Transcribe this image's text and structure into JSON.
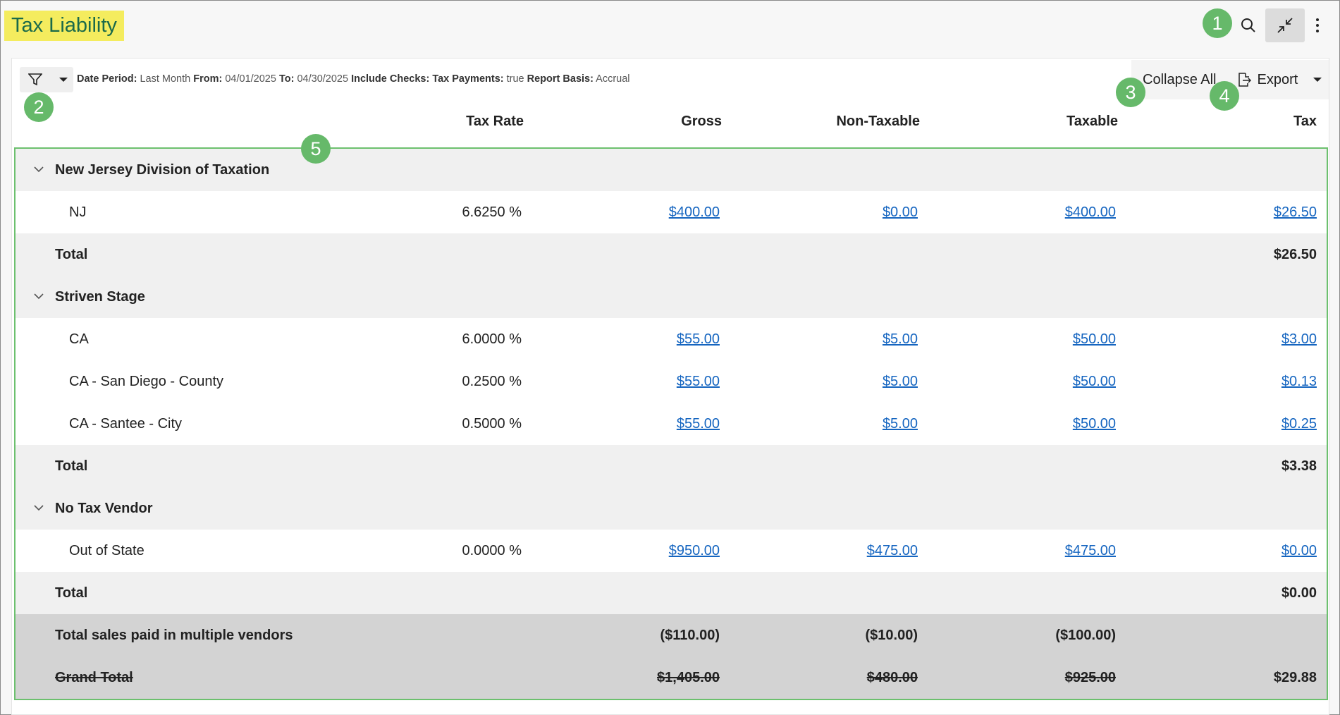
{
  "header": {
    "title": "Tax Liability"
  },
  "badges": [
    "1",
    "2",
    "3",
    "4",
    "5"
  ],
  "filter": {
    "date_period_label": "Date Period:",
    "date_period_value": "Last Month",
    "from_label": "From:",
    "from_value": "04/01/2025",
    "to_label": "To:",
    "to_value": "04/30/2025",
    "include_checks_label": "Include Checks:",
    "tax_payments_label": "Tax Payments:",
    "tax_payments_value": "true",
    "report_basis_label": "Report Basis:",
    "report_basis_value": "Accrual"
  },
  "toolbar": {
    "collapse_label": "Collapse All",
    "export_label": "Export"
  },
  "columns": {
    "rate": "Tax Rate",
    "gross": "Gross",
    "non_taxable": "Non-Taxable",
    "taxable": "Taxable",
    "tax": "Tax"
  },
  "groups": [
    {
      "name": "New Jersey Division of Taxation",
      "rows": [
        {
          "name": "NJ",
          "rate": "6.6250 %",
          "gross": "$400.00",
          "non_taxable": "$0.00",
          "taxable": "$400.00",
          "tax": "$26.50"
        }
      ],
      "total_label": "Total",
      "total_tax": "$26.50"
    },
    {
      "name": "Striven Stage",
      "rows": [
        {
          "name": "CA",
          "rate": "6.0000 %",
          "gross": "$55.00",
          "non_taxable": "$5.00",
          "taxable": "$50.00",
          "tax": "$3.00"
        },
        {
          "name": "CA - San Diego - County",
          "rate": "0.2500 %",
          "gross": "$55.00",
          "non_taxable": "$5.00",
          "taxable": "$50.00",
          "tax": "$0.13"
        },
        {
          "name": "CA - Santee - City",
          "rate": "0.5000 %",
          "gross": "$55.00",
          "non_taxable": "$5.00",
          "taxable": "$50.00",
          "tax": "$0.25"
        }
      ],
      "total_label": "Total",
      "total_tax": "$3.38"
    },
    {
      "name": "No Tax Vendor",
      "rows": [
        {
          "name": "Out of State",
          "rate": "0.0000 %",
          "gross": "$950.00",
          "non_taxable": "$475.00",
          "taxable": "$475.00",
          "tax": "$0.00"
        }
      ],
      "total_label": "Total",
      "total_tax": "$0.00"
    }
  ],
  "multi_vendor": {
    "label": "Total sales paid in multiple vendors",
    "gross": "($110.00)",
    "non_taxable": "($10.00)",
    "taxable": "($100.00)"
  },
  "grand_total": {
    "label": "Grand Total",
    "gross": "$1,405.00",
    "non_taxable": "$480.00",
    "taxable": "$925.00",
    "tax": "$29.88"
  }
}
